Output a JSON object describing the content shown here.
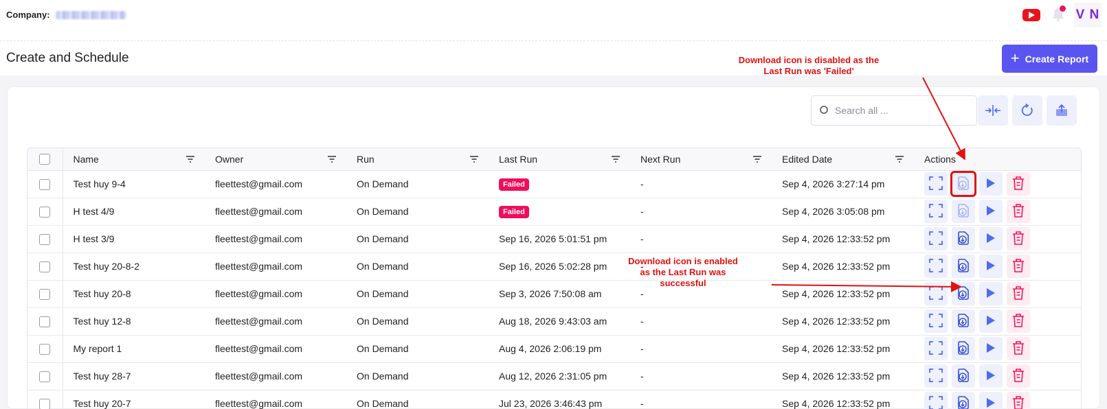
{
  "header": {
    "company_label": "Company:",
    "avatar_initials": "V N"
  },
  "page": {
    "title": "Create and Schedule",
    "create_button_label": "Create Report"
  },
  "toolbar": {
    "search_placeholder": "Search all ..."
  },
  "table": {
    "columns": [
      "Name",
      "Owner",
      "Run",
      "Last Run",
      "Next Run",
      "Edited Date",
      "Actions"
    ],
    "rows": [
      {
        "name": "Test huy 9-4",
        "owner": "fleettest@gmail.com",
        "run": "On Demand",
        "last_run": "Failed",
        "last_failed": true,
        "next_run": "-",
        "edited": "Sep 4, 2026 3:27:14 pm",
        "download_enabled": false
      },
      {
        "name": "H test 4/9",
        "owner": "fleettest@gmail.com",
        "run": "On Demand",
        "last_run": "Failed",
        "last_failed": true,
        "next_run": "-",
        "edited": "Sep 4, 2026 3:05:08 pm",
        "download_enabled": false
      },
      {
        "name": "H test 3/9",
        "owner": "fleettest@gmail.com",
        "run": "On Demand",
        "last_run": "Sep 16, 2026 5:01:51 pm",
        "last_failed": false,
        "next_run": "-",
        "edited": "Sep 4, 2026 12:33:52 pm",
        "download_enabled": true
      },
      {
        "name": "Test huy 20-8-2",
        "owner": "fleettest@gmail.com",
        "run": "On Demand",
        "last_run": "Sep 16, 2026 5:02:28 pm",
        "last_failed": false,
        "next_run": "-",
        "edited": "Sep 4, 2026 12:33:52 pm",
        "download_enabled": true
      },
      {
        "name": "Test huy 20-8",
        "owner": "fleettest@gmail.com",
        "run": "On Demand",
        "last_run": "Sep 3, 2026 7:50:08 am",
        "last_failed": false,
        "next_run": "-",
        "edited": "Sep 4, 2026 12:33:52 pm",
        "download_enabled": true
      },
      {
        "name": "Test huy 12-8",
        "owner": "fleettest@gmail.com",
        "run": "On Demand",
        "last_run": "Aug 18, 2026 9:43:03 am",
        "last_failed": false,
        "next_run": "-",
        "edited": "Sep 4, 2026 12:33:52 pm",
        "download_enabled": true
      },
      {
        "name": "My report 1",
        "owner": "fleettest@gmail.com",
        "run": "On Demand",
        "last_run": "Aug 4, 2026 2:06:19 pm",
        "last_failed": false,
        "next_run": "-",
        "edited": "Sep 4, 2026 12:33:52 pm",
        "download_enabled": true
      },
      {
        "name": "Test huy 28-7",
        "owner": "fleettest@gmail.com",
        "run": "On Demand",
        "last_run": "Aug 12, 2026 2:31:05 pm",
        "last_failed": false,
        "next_run": "-",
        "edited": "Sep 4, 2026 12:33:52 pm",
        "download_enabled": true
      },
      {
        "name": "Test huy 20-7",
        "owner": "fleettest@gmail.com",
        "run": "On Demand",
        "last_run": "Jul 23, 2026 3:46:43 pm",
        "last_failed": false,
        "next_run": "-",
        "edited": "Sep 4, 2026 12:33:52 pm",
        "download_enabled": true
      }
    ]
  },
  "annotations": {
    "disabled_note": "Download icon is disabled as the Last Run was 'Failed'",
    "enabled_note": "Download icon is enabled as the Last Run was successful"
  },
  "colors": {
    "accent": "#5a55f0",
    "failed_badge": "#f00d5b",
    "annotation": "#e31010",
    "delete": "#f0135b"
  }
}
